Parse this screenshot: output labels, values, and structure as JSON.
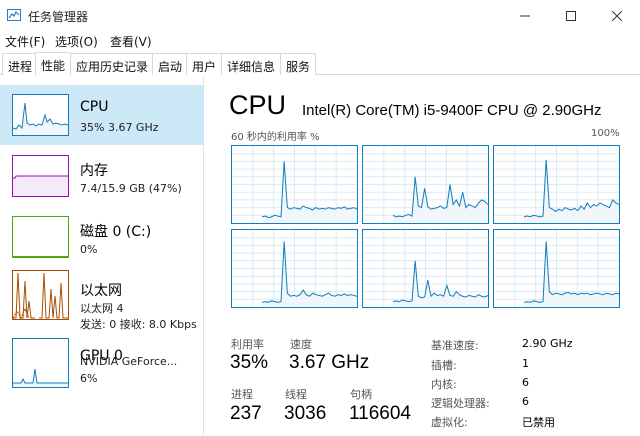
{
  "window": {
    "title": "任务管理器"
  },
  "menu": [
    "文件(F)",
    "选项(O)",
    "查看(V)"
  ],
  "tabs": [
    "进程",
    "性能",
    "应用历史记录",
    "启动",
    "用户",
    "详细信息",
    "服务"
  ],
  "active_tab": "性能",
  "sidebar": {
    "items": [
      {
        "title": "CPU",
        "line1": "35%  3.67 GHz",
        "color": "#117dbb",
        "selected": true,
        "icon": "cpu-graph-icon"
      },
      {
        "title": "内存",
        "line1": "7.4/15.9 GB (47%)",
        "color": "#8b12ae",
        "selected": false,
        "icon": "memory-graph-icon"
      },
      {
        "title": "磁盘 0 (C:)",
        "line1": "0%",
        "color": "#4da60c",
        "selected": false,
        "icon": "disk-graph-icon"
      },
      {
        "title": "以太网",
        "line1": "以太网 4",
        "line2": "发送: 0  接收: 8.0 Kbps",
        "color": "#a74f01",
        "selected": false,
        "icon": "ethernet-graph-icon"
      },
      {
        "title": "GPU 0",
        "line1": "NVIDIA GeForce...",
        "line2": "6%",
        "color": "#117dbb",
        "selected": false,
        "icon": "gpu-graph-icon"
      }
    ]
  },
  "main": {
    "heading": "CPU",
    "model": "Intel(R) Core(TM) i5-9400F CPU @ 2.90GHz",
    "graph_label": "60 秒内的利用率 %",
    "graph_max": "100%",
    "core_count_graphs": 6,
    "line_color": "#117dbb",
    "stats": {
      "utilization_label": "利用率",
      "utilization": "35%",
      "speed_label": "速度",
      "speed": "3.67 GHz",
      "processes_label": "进程",
      "processes": "237",
      "threads_label": "线程",
      "threads": "3036",
      "handles_label": "句柄",
      "handles": "116604"
    },
    "info": [
      {
        "label": "基准速度:",
        "value": "2.90 GHz"
      },
      {
        "label": "插槽:",
        "value": "1"
      },
      {
        "label": "内核:",
        "value": "6"
      },
      {
        "label": "逻辑处理器:",
        "value": "6"
      },
      {
        "label": "虚拟化:",
        "value": "已禁用"
      }
    ]
  }
}
